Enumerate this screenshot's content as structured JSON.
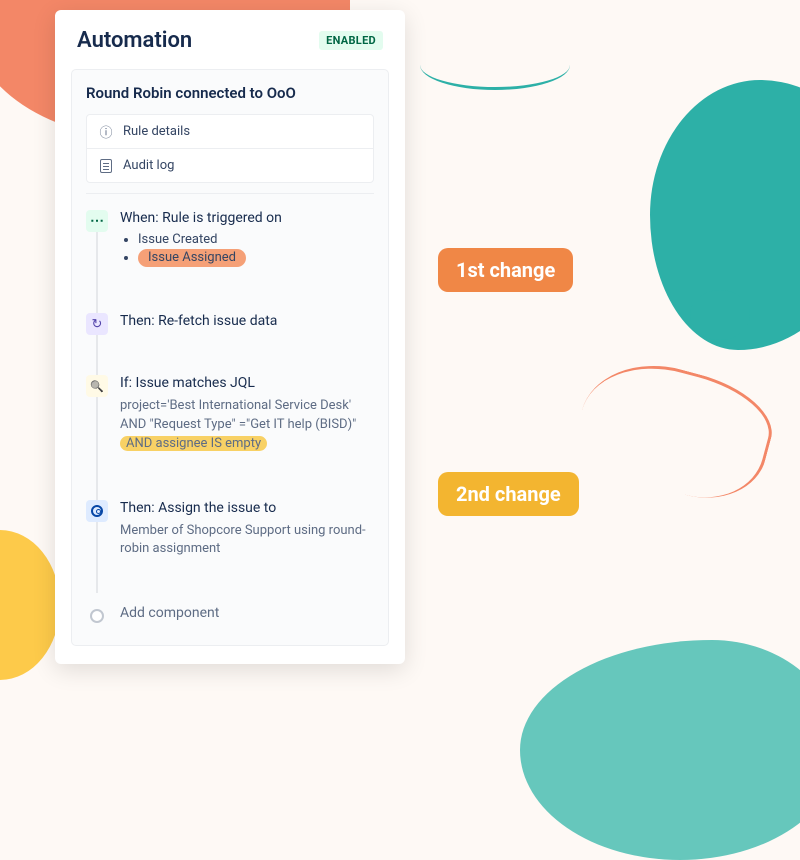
{
  "header": {
    "title": "Automation",
    "status": "ENABLED"
  },
  "rule": {
    "title": "Round Robin connected to OoO",
    "nav": {
      "details": "Rule details",
      "audit": "Audit log"
    }
  },
  "steps": {
    "trigger": {
      "title": "When: Rule is triggered on",
      "items": [
        "Issue Created",
        "Issue Assigned"
      ]
    },
    "refetch": {
      "title": "Then: Re-fetch issue data"
    },
    "condition": {
      "title": "If: Issue matches JQL",
      "jql_prefix": "project='Best International Service Desk' AND \"Request Type\" =\"Get IT help (BISD)\" ",
      "jql_highlight": "AND assignee IS empty"
    },
    "action": {
      "title": "Then: Assign the issue to",
      "body": "Member of Shopcore Support using round-robin assignment"
    },
    "add": {
      "label": "Add component"
    }
  },
  "annotations": {
    "first": "1st change",
    "second": "2nd change"
  }
}
